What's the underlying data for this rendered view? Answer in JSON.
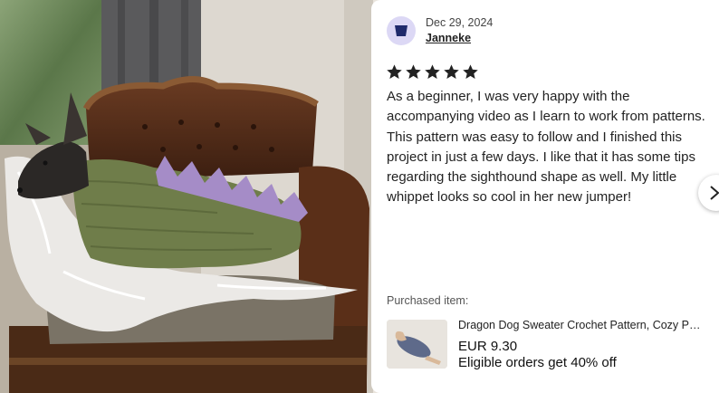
{
  "review": {
    "date": "Dec 29, 2024",
    "reviewer": "Janneke",
    "rating": 5,
    "stars": [
      1,
      2,
      3,
      4,
      5
    ],
    "text": "As a beginner, I was very happy with the accompanying video as I learn to work from patterns. This pattern was easy to follow and I finished this project in just a few days. I like that it has some tips regarding the sighthound shape as well. My little whippet looks so cool in her new jumper!"
  },
  "purchased": {
    "label": "Purchased item:",
    "title": "Dragon Dog Sweater Crochet Pattern, Cozy Pattern for Sighthounds",
    "price": "EUR 9.30",
    "promo": "Eligible orders get 40% off"
  },
  "icons": {
    "avatar": "avatar-placeholder-icon",
    "star": "star-icon",
    "next": "chevron-right-icon"
  },
  "colors": {
    "star": "#222222",
    "avatar_bg": "#dcd8f5",
    "avatar_icon": "#1f2a6b"
  }
}
